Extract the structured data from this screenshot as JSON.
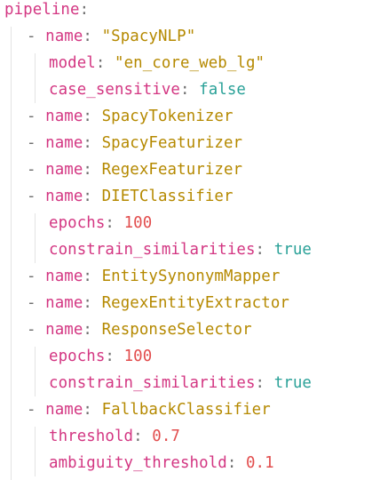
{
  "root_key": "pipeline",
  "components": [
    {
      "name_key": "name",
      "name": "\"SpacyNLP\"",
      "props": [
        {
          "key": "model",
          "value": "\"en_core_web_lg\"",
          "type": "str"
        },
        {
          "key": "case_sensitive",
          "value": "false",
          "type": "bool"
        }
      ]
    },
    {
      "name_key": "name",
      "name": "SpacyTokenizer",
      "props": []
    },
    {
      "name_key": "name",
      "name": "SpacyFeaturizer",
      "props": []
    },
    {
      "name_key": "name",
      "name": "RegexFeaturizer",
      "props": []
    },
    {
      "name_key": "name",
      "name": "DIETClassifier",
      "props": [
        {
          "key": "epochs",
          "value": "100",
          "type": "num"
        },
        {
          "key": "constrain_similarities",
          "value": "true",
          "type": "bool"
        }
      ]
    },
    {
      "name_key": "name",
      "name": "EntitySynonymMapper",
      "props": []
    },
    {
      "name_key": "name",
      "name": "RegexEntityExtractor",
      "props": []
    },
    {
      "name_key": "name",
      "name": "ResponseSelector",
      "props": [
        {
          "key": "epochs",
          "value": "100",
          "type": "num"
        },
        {
          "key": "constrain_similarities",
          "value": "true",
          "type": "bool"
        }
      ]
    },
    {
      "name_key": "name",
      "name": "FallbackClassifier",
      "props": [
        {
          "key": "threshold",
          "value": "0.7",
          "type": "num"
        },
        {
          "key": "ambiguity_threshold",
          "value": "0.1",
          "type": "num"
        }
      ]
    }
  ],
  "colors": {
    "key": "#d33682",
    "string": "#b58900",
    "number": "#e24d4d",
    "boolean": "#2aa198",
    "punctuation": "#6f6f6f",
    "indent_guide": "#e3e3e3",
    "background": "#ffffff"
  }
}
